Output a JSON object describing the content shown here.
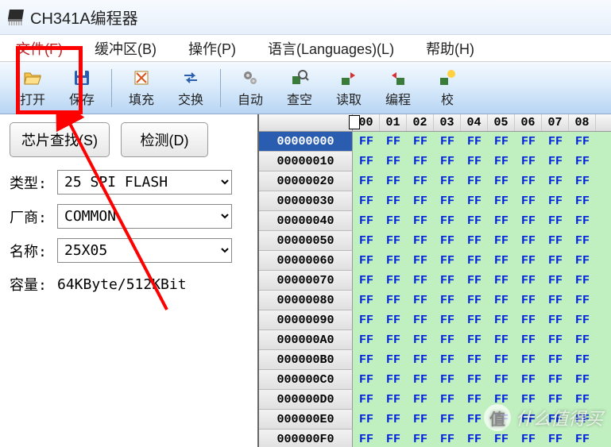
{
  "title": "CH341A编程器",
  "menu": {
    "file": "文件(F)",
    "buffer": "缓冲区(B)",
    "operate": "操作(P)",
    "language": "语言(Languages)(L)",
    "help": "帮助(H)"
  },
  "toolbar": {
    "open": "打开",
    "save": "保存",
    "fill": "填充",
    "swap": "交换",
    "auto": "自动",
    "blank": "查空",
    "read": "读取",
    "program": "编程",
    "verify": "校"
  },
  "left": {
    "chip_search_btn": "芯片查找(S)",
    "detect_btn": "检测(D)",
    "type_label": "类型:",
    "type_value": "25 SPI FLASH",
    "vendor_label": "厂商:",
    "vendor_value": "COMMON",
    "name_label": "名称:",
    "name_value": "25X05",
    "capacity_label": "容量:",
    "capacity_value": "64KByte/512KBit"
  },
  "hex": {
    "columns": [
      "00",
      "01",
      "02",
      "03",
      "04",
      "05",
      "06",
      "07",
      "08"
    ],
    "addresses": [
      "00000000",
      "00000010",
      "00000020",
      "00000030",
      "00000040",
      "00000050",
      "00000060",
      "00000070",
      "00000080",
      "00000090",
      "000000A0",
      "000000B0",
      "000000C0",
      "000000D0",
      "000000E0",
      "000000F0"
    ],
    "byte": "FF",
    "selected_row": 0
  },
  "watermark": {
    "badge": "值",
    "text": "什么值得买"
  }
}
